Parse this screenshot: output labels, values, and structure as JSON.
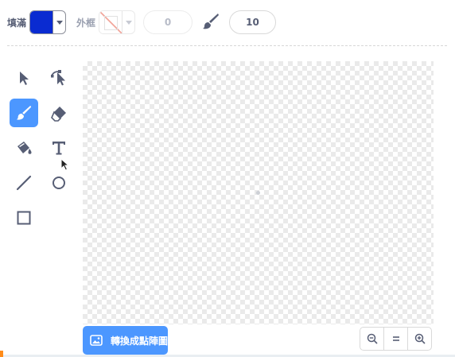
{
  "toolbar": {
    "fill_label": "填滿",
    "fill_color": "#0a2bd1",
    "outline_label": "外框",
    "outline_width": "0",
    "brush_size": "10"
  },
  "tools": [
    {
      "name": "select",
      "icon": "arrow-cursor-icon",
      "active": false
    },
    {
      "name": "reshape",
      "icon": "reshape-icon",
      "active": false
    },
    {
      "name": "brush",
      "icon": "paintbrush-icon",
      "active": true
    },
    {
      "name": "eraser",
      "icon": "eraser-icon",
      "active": false
    },
    {
      "name": "fill",
      "icon": "paint-bucket-icon",
      "active": false
    },
    {
      "name": "text",
      "icon": "text-icon",
      "active": false
    },
    {
      "name": "line",
      "icon": "line-icon",
      "active": false
    },
    {
      "name": "circle",
      "icon": "circle-icon",
      "active": false
    },
    {
      "name": "rectangle",
      "icon": "rectangle-icon",
      "active": false
    }
  ],
  "footer": {
    "convert_label": "轉換成點陣圖"
  },
  "colors": {
    "accent": "#4c97ff",
    "icon_dark": "#575e75"
  }
}
